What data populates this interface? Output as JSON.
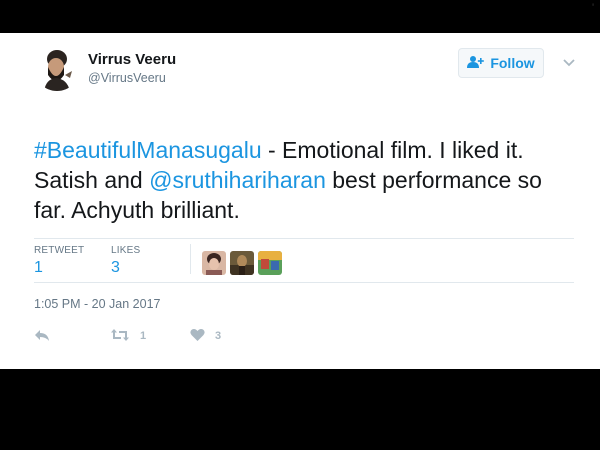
{
  "tweet": {
    "author": {
      "name": "Virrus Veeru",
      "handle": "@VirrusVeeru"
    },
    "follow_label": "Follow",
    "text_parts": {
      "hashtag": "#BeautifulManasugalu",
      "part1": "  - Emotional film. I liked it. Satish and ",
      "mention": "@sruthihariharan",
      "part2": " best performance so far. Achyuth brilliant."
    },
    "stats": {
      "retweet_label": "RETWEET",
      "retweet_count": "1",
      "likes_label": "LIKES",
      "likes_count": "3"
    },
    "timestamp": "1:05 PM - 20 Jan 2017",
    "actions": {
      "retweet_count": "1",
      "like_count": "3"
    }
  },
  "colors": {
    "link": "#1b95e0",
    "secondary": "#657786",
    "icon": "#aab8c2",
    "divider": "#e1e8ed"
  },
  "icons": [
    "avatar",
    "add-user-icon",
    "chevron-down-icon",
    "reply-icon",
    "retweet-icon",
    "heart-icon"
  ]
}
